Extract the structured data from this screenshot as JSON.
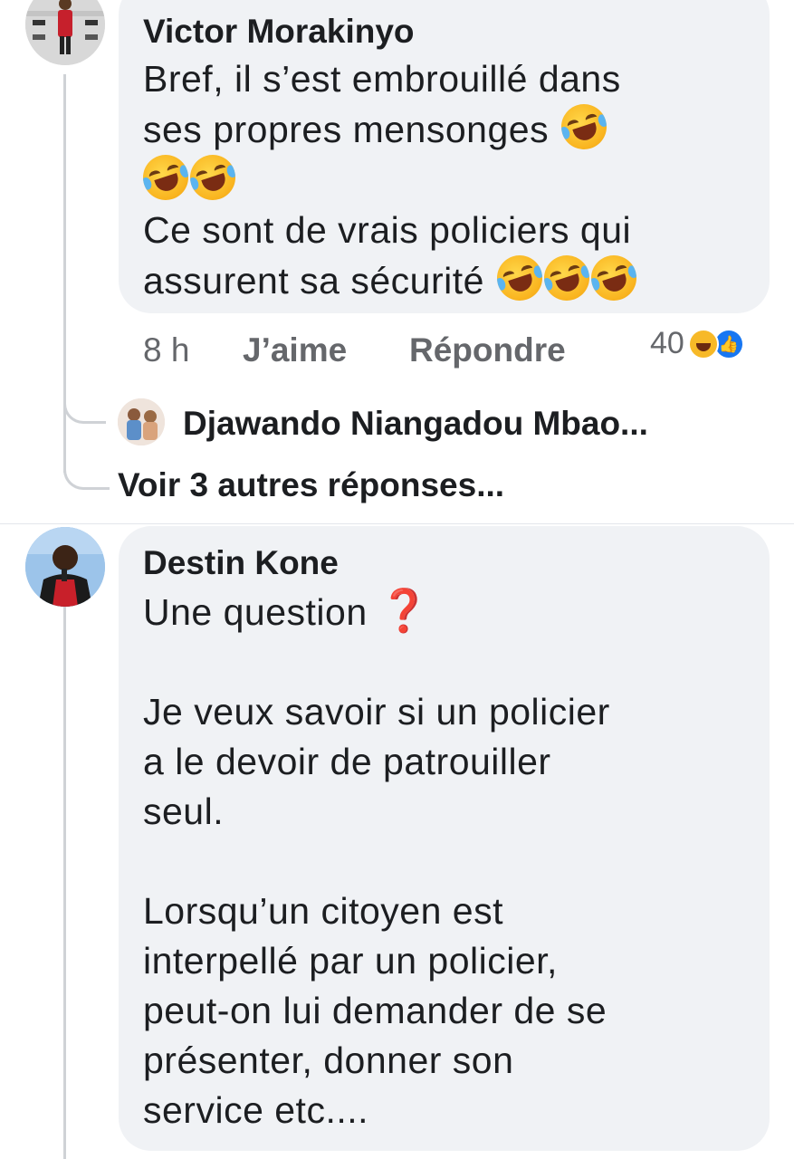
{
  "comments": [
    {
      "author": "Victor Morakinyo",
      "lines": [
        {
          "text": "Bref, il s’est embrouillé dans",
          "emojis": 0
        },
        {
          "text": "ses propres mensonges",
          "emojis": 1
        },
        {
          "text": "",
          "emojis": 2
        },
        {
          "text": "Ce sont de vrais policiers qui",
          "emojis": 0
        },
        {
          "text": "assurent sa sécurité",
          "emojis": 3
        }
      ],
      "time": "8 h",
      "like_label": "J’aime",
      "reply_label": "Répondre",
      "reaction_count": "40",
      "reactions": [
        "haha-icon",
        "like-icon"
      ]
    },
    {
      "author": "Destin Kone",
      "line1": "Une question",
      "line1_emoji": "❓",
      "lines": [
        "Je veux savoir si un policier",
        "a le devoir de patrouiller",
        "seul.",
        "",
        "Lorsqu’un citoyen est",
        "interpellé par un policier,",
        "peut-on lui demander de se",
        "présenter, donner son",
        "service etc...."
      ]
    }
  ],
  "reply_preview": {
    "author": "Djawando Niangadou Mbao..."
  },
  "more_replies_label": "Voir 3 autres réponses...",
  "colors": {
    "bubble": "#f0f2f5",
    "meta": "#65676b",
    "like": "#1877f2",
    "haha": "#f7b928"
  }
}
